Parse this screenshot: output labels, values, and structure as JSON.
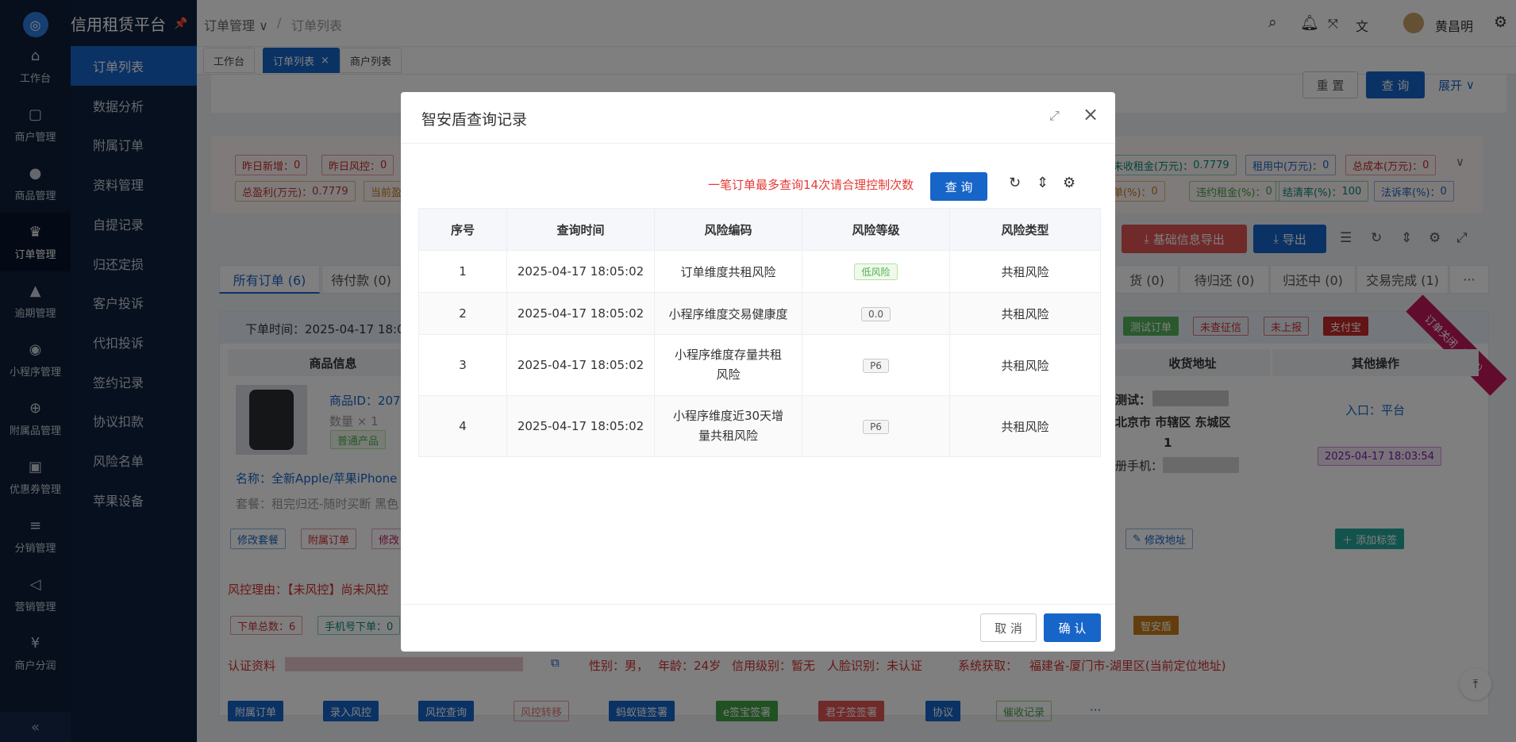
{
  "app": {
    "name": "信用租赁平台"
  },
  "rail": [
    {
      "label": "工作台",
      "icon": "home-icon",
      "glyph": "⌂"
    },
    {
      "label": "商户管理",
      "icon": "bag-icon",
      "glyph": "▢"
    },
    {
      "label": "商品管理",
      "icon": "apple-icon",
      "glyph": "●"
    },
    {
      "label": "订单管理",
      "icon": "trophy-icon",
      "glyph": "♛"
    },
    {
      "label": "逾期管理",
      "icon": "bell-icon",
      "glyph": "▲"
    },
    {
      "label": "小程序管理",
      "icon": "robot-icon",
      "glyph": "◉"
    },
    {
      "label": "附属品管理",
      "icon": "cart-icon",
      "glyph": "⊕"
    },
    {
      "label": "优惠券管理",
      "icon": "gift-icon",
      "glyph": "▣"
    },
    {
      "label": "分销管理",
      "icon": "sliders-icon",
      "glyph": "≡"
    },
    {
      "label": "营销管理",
      "icon": "megaphone-icon",
      "glyph": "◁"
    },
    {
      "label": "商户分润",
      "icon": "yen-icon",
      "glyph": "¥"
    }
  ],
  "submenu": [
    "订单列表",
    "数据分析",
    "附属订单",
    "资料管理",
    "自提记录",
    "归还定损",
    "客户投诉",
    "代扣投诉",
    "签约记录",
    "协议扣款",
    "风险名单",
    "苹果设备"
  ],
  "breadcrumb": {
    "parent": "订单管理",
    "sep": "/",
    "current": "订单列表"
  },
  "user": {
    "name": "黄昌明"
  },
  "tabs": [
    {
      "label": "工作台"
    },
    {
      "label": "订单列表"
    },
    {
      "label": "商户列表"
    }
  ],
  "filter": {
    "reset": "重 置",
    "query": "查 询",
    "expand": "展开"
  },
  "stats": [
    {
      "text": "昨日新增：",
      "value": "0"
    },
    {
      "text": "昨日风控：",
      "value": "0"
    },
    {
      "text": "总盈利(万元)：",
      "value": "0.7779"
    },
    {
      "text": "当前盈",
      "value": ""
    },
    {
      "text": "未收租金(万元)：",
      "value": "0.7779"
    },
    {
      "text": "租用中(万元)：",
      "value": "0"
    },
    {
      "text": "总成本(万元)：",
      "value": "0"
    },
    {
      "text": "单(%)：",
      "value": "0"
    },
    {
      "text": "违约租金(%)：",
      "value": "0"
    },
    {
      "text": "结清率(%)：",
      "value": "100"
    },
    {
      "text": "法诉率(%)：",
      "value": "0"
    }
  ],
  "actions": {
    "export_basic": "基础信息导出",
    "export": "导出"
  },
  "order_tabs": [
    {
      "label": "所有订单 (6)"
    },
    {
      "label": "待付款 (0)"
    },
    {
      "label": "货 (0)"
    },
    {
      "label": "待归还 (0)"
    },
    {
      "label": "归还中 (0)"
    },
    {
      "label": "交易完成 (1)"
    },
    {
      "label": "···"
    }
  ],
  "order": {
    "time_label": "下单时间：2025-04-17 18:0",
    "tags": [
      "测试订单",
      "未查征信",
      "未上报",
      "支付宝"
    ],
    "ribbon": "订单关闭（商家）",
    "col_goods": "商品信息",
    "col_addr": "收货地址",
    "col_ops": "其他操作",
    "goods_id": "商品ID：207",
    "qty": "数量 × 1",
    "goods_tag": "普通产品",
    "name": "名称：全新Apple/苹果iPhone",
    "pkg": "套餐：租完归还-随时买断 黑色",
    "addr_l1": "测试：",
    "addr_l2": "北京市 市辖区 东城区",
    "addr_l3": "1",
    "addr_l4": "册手机：",
    "entry": "入口：平台",
    "entry_time": "2025-04-17 18:03:54",
    "btn_modify_pkg": "修改套餐",
    "btn_sub_order": "附属订单",
    "btn_modify": "修改",
    "btn_modify_addr": "修改地址",
    "btn_add_tag": "添加标签",
    "risk_reason": "风控理由：【未风控】尚未风控",
    "count_a": "下单总数：6",
    "count_b": "手机号下单：0",
    "zhian_tag": "智安盾",
    "cert": "认证资料",
    "gender": "性别：男，",
    "age": "年龄：24岁",
    "credit": "信用级别：暂无",
    "face": "人脸识别：未认证",
    "sys": "系统获取：",
    "location": "福建省-厦门市-湖里区(当前定位地址)",
    "bottom_btns": [
      "附属订单",
      "录入风控",
      "风控查询",
      "风控转移",
      "蚂蚁链签署",
      "e签宝签署",
      "君子签签署",
      "协议",
      "催收记录",
      "···"
    ]
  },
  "dialog": {
    "title": "智安盾查询记录",
    "warning": "一笔订单最多查询14次请合理控制次数",
    "query_btn": "查 询",
    "headers": [
      "序号",
      "查询时间",
      "风险编码",
      "风险等级",
      "风险类型"
    ],
    "rows": [
      {
        "no": "1",
        "time": "2025-04-17 18:05:02",
        "code": "订单维度共租风险",
        "level": "低风险",
        "type": "共租风险"
      },
      {
        "no": "2",
        "time": "2025-04-17 18:05:02",
        "code": "小程序维度交易健康度",
        "level": "0.0",
        "type": "共租风险"
      },
      {
        "no": "3",
        "time": "2025-04-17 18:05:02",
        "code": "小程序维度存量共租风险",
        "level": "P6",
        "type": "共租风险"
      },
      {
        "no": "4",
        "time": "2025-04-17 18:05:02",
        "code": "小程序维度近30天增量共租风险",
        "level": "P6",
        "type": "共租风险"
      }
    ],
    "cancel": "取 消",
    "confirm": "确 认"
  }
}
